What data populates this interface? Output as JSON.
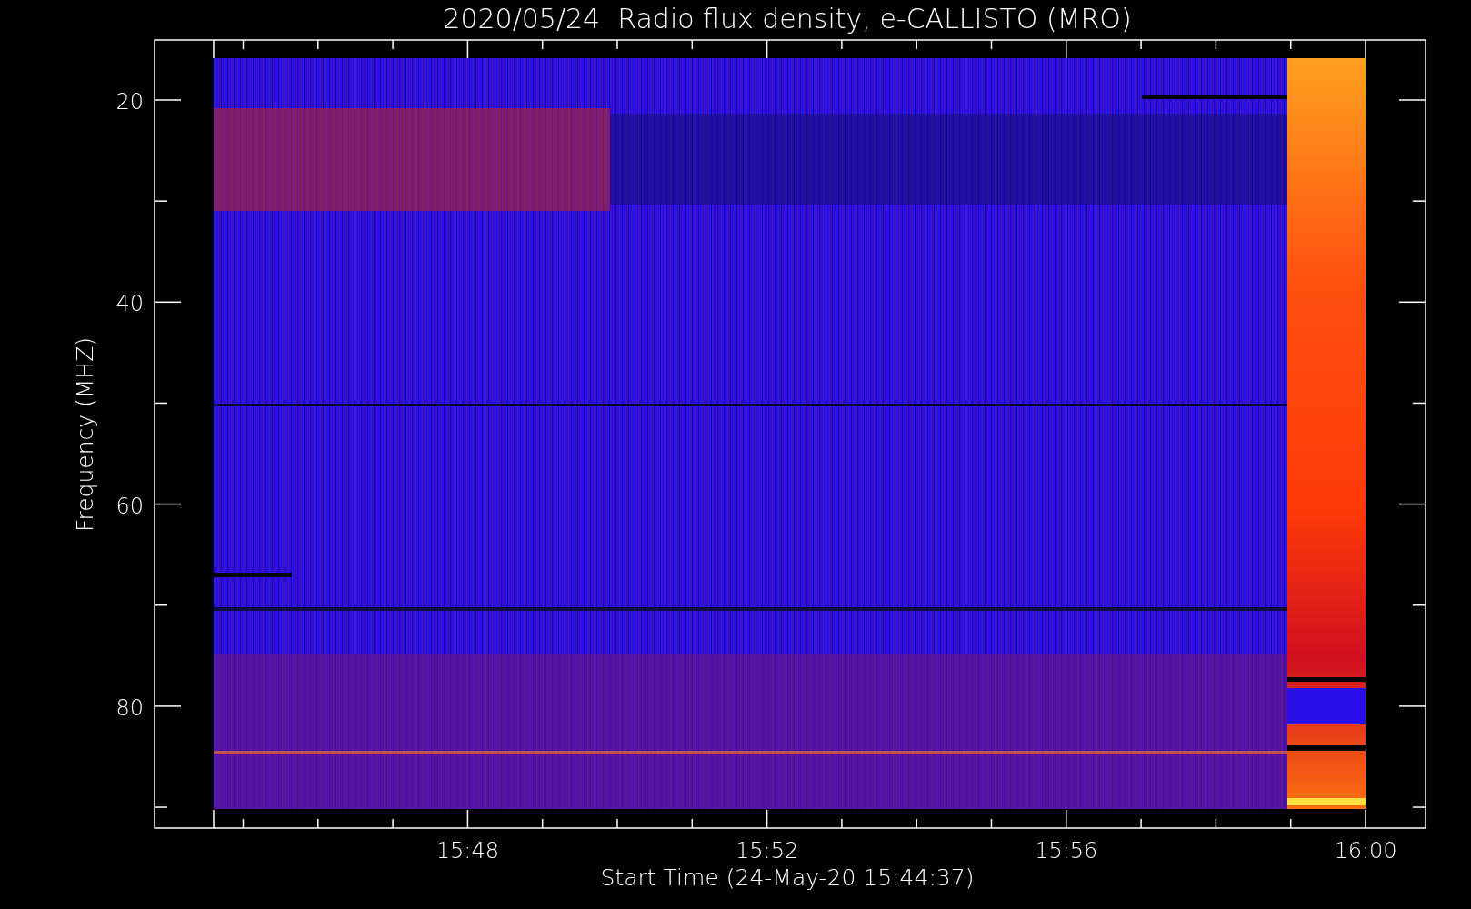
{
  "title": "2020/05/24  Radio flux density, e-CALLISTO (MRO)",
  "y_axis": {
    "label": "Frequency (MHZ)",
    "ticks": [
      "20",
      "40",
      "60",
      "80"
    ]
  },
  "x_axis": {
    "label": "Start Time (24-May-20 15:44:37)",
    "ticks": [
      "15:48",
      "15:52",
      "15:56",
      "16:00"
    ]
  }
}
